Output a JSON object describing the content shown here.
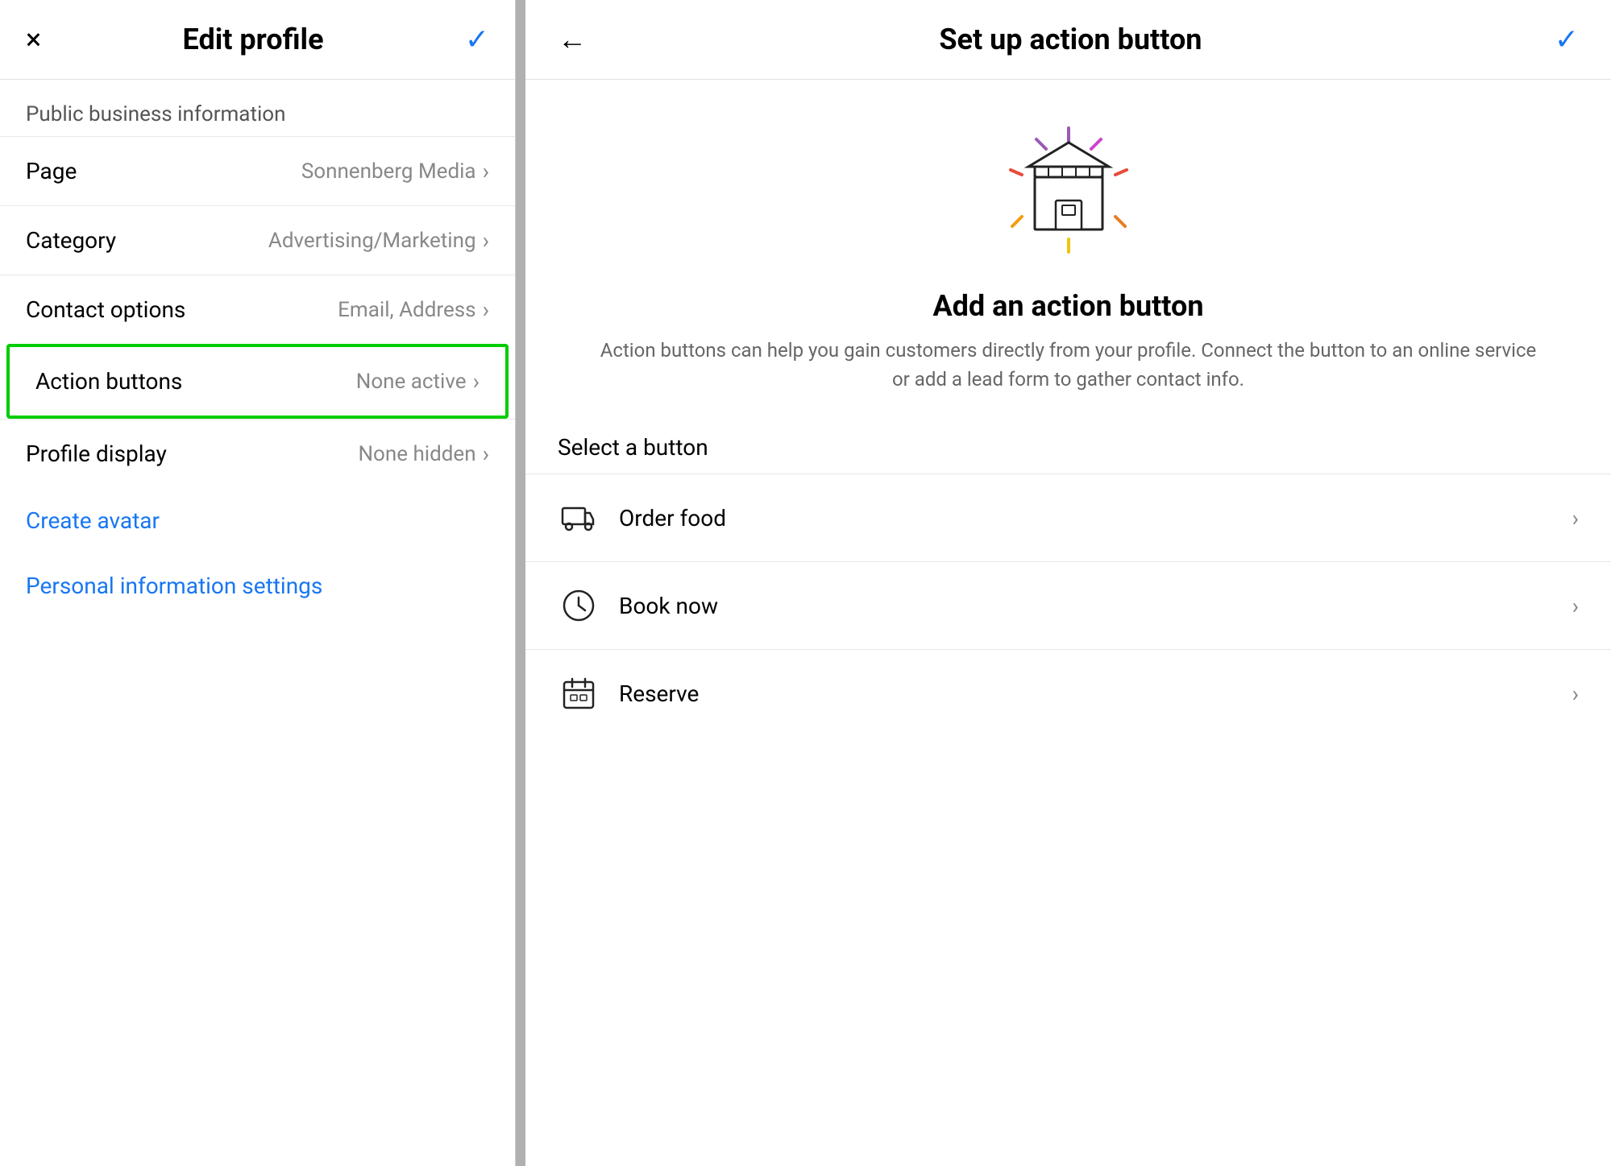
{
  "left": {
    "header": {
      "title": "Edit profile",
      "close_label": "×",
      "check_label": "✓"
    },
    "section_label": "Public business information",
    "menu_items": [
      {
        "label": "Page",
        "value": "Sonnenberg Media",
        "highlighted": false
      },
      {
        "label": "Category",
        "value": "Advertising/Marketing",
        "highlighted": false
      },
      {
        "label": "Contact options",
        "value": "Email, Address",
        "highlighted": false
      },
      {
        "label": "Action buttons",
        "value": "None active",
        "highlighted": true
      },
      {
        "label": "Profile display",
        "value": "None hidden",
        "highlighted": false
      }
    ],
    "links": [
      {
        "label": "Create avatar"
      },
      {
        "label": "Personal information settings"
      }
    ]
  },
  "right": {
    "header": {
      "title": "Set up action button",
      "back_label": "←",
      "check_label": "✓"
    },
    "add_title": "Add an action button",
    "add_desc": "Action buttons can help you gain customers directly from your profile. Connect the button to an online service or add a lead form to gather contact info.",
    "select_label": "Select a button",
    "action_items": [
      {
        "label": "Order food",
        "icon_type": "truck"
      },
      {
        "label": "Book now",
        "icon_type": "clock"
      },
      {
        "label": "Reserve",
        "icon_type": "calendar"
      }
    ]
  },
  "colors": {
    "blue": "#1877f2",
    "green": "#00cc00",
    "gray_text": "#888888",
    "dark_text": "#000000"
  }
}
